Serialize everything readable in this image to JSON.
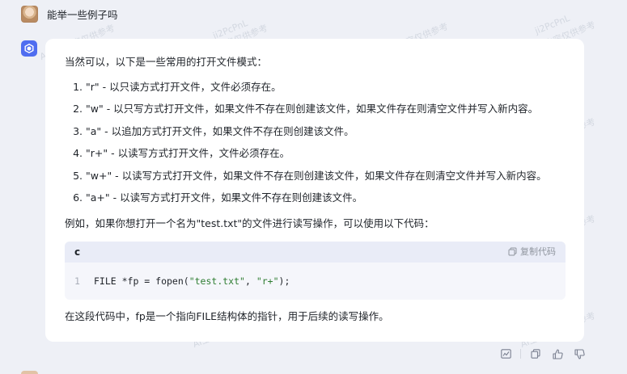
{
  "user_message": "能举一些例子吗",
  "answer": {
    "intro": "当然可以，以下是一些常用的打开文件模式：",
    "modes": [
      "\"r\" - 以只读方式打开文件，文件必须存在。",
      "\"w\" - 以只写方式打开文件，如果文件不存在则创建该文件，如果文件存在则清空文件并写入新内容。",
      "\"a\" - 以追加方式打开文件，如果文件不存在则创建该文件。",
      "\"r+\" - 以读写方式打开文件，文件必须存在。",
      "\"w+\" - 以读写方式打开文件，如果文件不存在则创建该文件，如果文件存在则清空文件并写入新内容。",
      "\"a+\" - 以读写方式打开文件，如果文件不存在则创建该文件。"
    ],
    "example": "例如，如果你想打开一个名为\"test.txt\"的文件进行读写操作，可以使用以下代码：",
    "code": {
      "language": "c",
      "copy_label": "复制代码",
      "line_number": "1",
      "prefix": "FILE *fp = fopen(",
      "arg1": "\"test.txt\"",
      "sep": ", ",
      "arg2": "\"r+\"",
      "suffix": ");"
    },
    "explanation": "在这段代码中，fp是一个指向FILE结构体的指针，用于后续的读写操作。"
  },
  "watermark": {
    "line1": "ji2PcPnL",
    "line2": "AI生成内容仅供参考"
  },
  "actions": [
    "chart-icon",
    "copy-icon",
    "thumbs-up-icon",
    "thumbs-down-icon"
  ],
  "colors": {
    "bot_icon": "#4f6df0",
    "page_bg": "#eef0f6",
    "code_string": "#2e7d32"
  }
}
